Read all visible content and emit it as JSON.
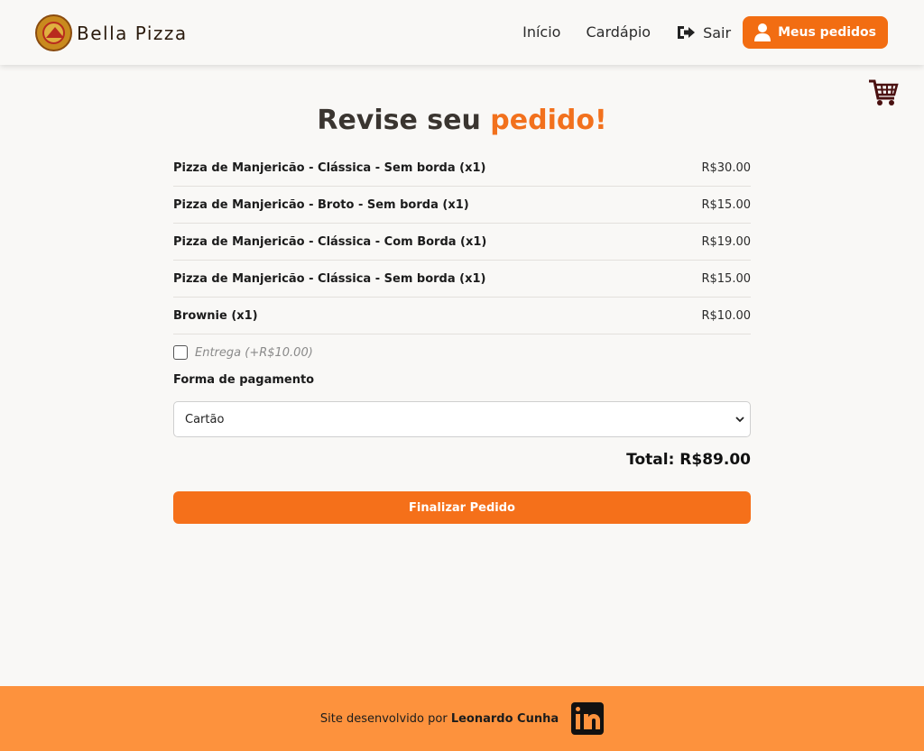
{
  "header": {
    "brand_name": "Bella Pizza",
    "nav": {
      "home": "Início",
      "menu": "Cardápio",
      "logout": "Sair",
      "orders_button": "Meus pedidos"
    }
  },
  "main": {
    "title_prefix": "Revise seu",
    "title_accent": "pedido!",
    "items": [
      {
        "name": "Pizza de Manjericão - Clássica - Sem borda (x1)",
        "price": "R$30.00"
      },
      {
        "name": "Pizza de Manjericão - Broto - Sem borda (x1)",
        "price": "R$15.00"
      },
      {
        "name": "Pizza de Manjericão - Clássica - Com Borda (x1)",
        "price": "R$19.00"
      },
      {
        "name": "Pizza de Manjericão - Clássica - Sem borda (x1)",
        "price": "R$15.00"
      },
      {
        "name": "Brownie (x1)",
        "price": "R$10.00"
      }
    ],
    "delivery_label": "Entrega (+R$10.00)",
    "delivery_checked": false,
    "payment_label": "Forma de pagamento",
    "payment_selected": "Cartão",
    "total": "Total: R$89.00",
    "finish_button": "Finalizar Pedido"
  },
  "footer": {
    "prefix": "Site desenvolvido por",
    "author": "Leonardo Cunha"
  },
  "icons": {
    "cart": "shopping-cart-icon",
    "logout": "sign-out-icon",
    "user": "user-icon",
    "linkedin": "linkedin-icon"
  },
  "colors": {
    "accent": "#f26d12",
    "footer_bg": "#fd923d",
    "page_bg": "#f9f8f6",
    "cart_icon": "#4a1010"
  }
}
